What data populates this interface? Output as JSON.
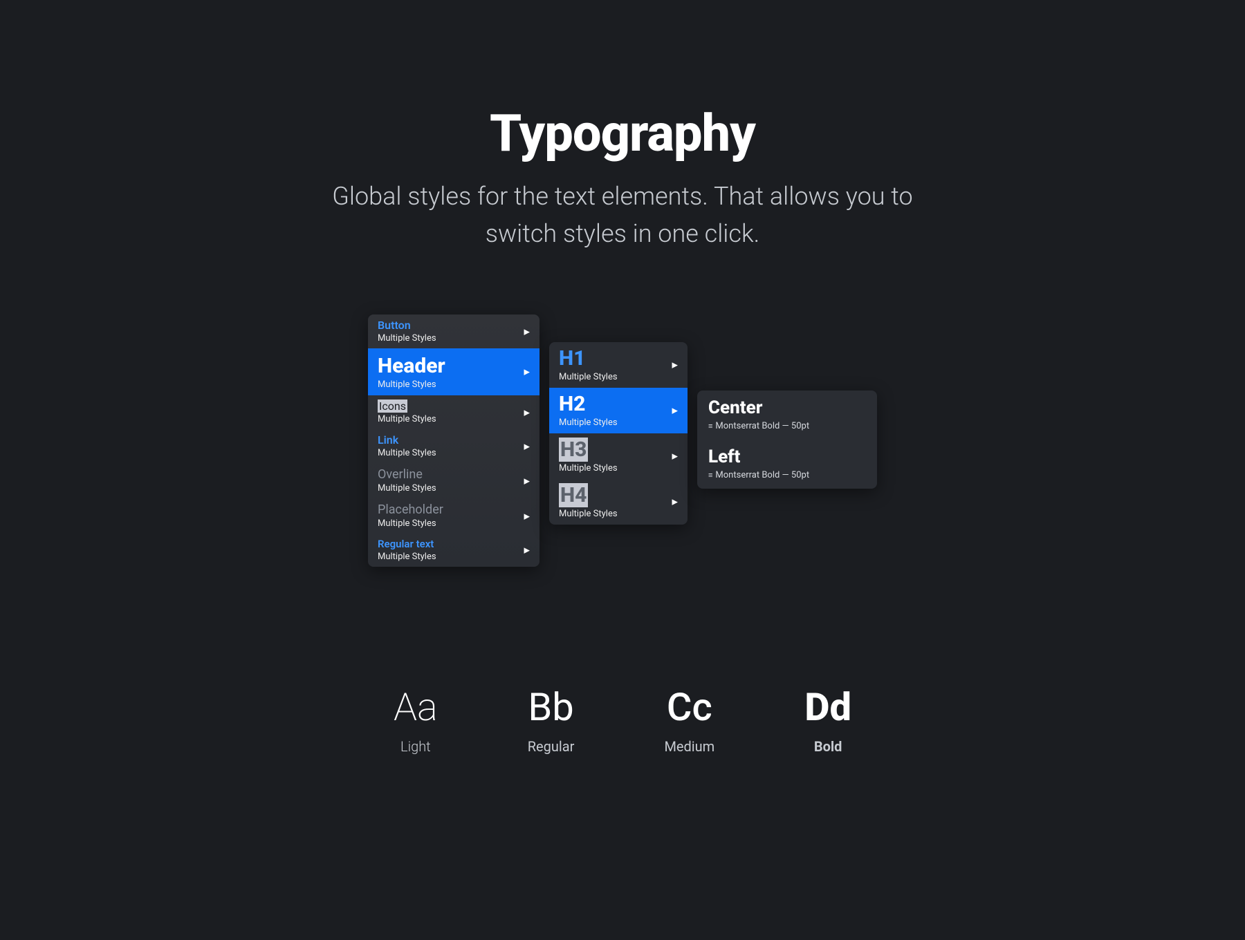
{
  "header": {
    "title": "Typography",
    "subtitle": "Global styles for the text elements. That allows you to switch styles in one click."
  },
  "panel1": {
    "items": [
      {
        "label": "Button",
        "sub": "Multiple Styles"
      },
      {
        "label": "Header",
        "sub": "Multiple Styles"
      },
      {
        "label": "Icons",
        "sub": "Multiple Styles"
      },
      {
        "label": "Link",
        "sub": "Multiple Styles"
      },
      {
        "label": "Overline",
        "sub": "Multiple Styles"
      },
      {
        "label": "Placeholder",
        "sub": "Multiple Styles"
      },
      {
        "label": "Regular text",
        "sub": "Multiple Styles"
      }
    ]
  },
  "panel2": {
    "items": [
      {
        "label": "H1",
        "sub": "Multiple Styles"
      },
      {
        "label": "H2",
        "sub": "Multiple Styles"
      },
      {
        "label": "H3",
        "sub": "Multiple Styles"
      },
      {
        "label": "H4",
        "sub": "Multiple Styles"
      }
    ]
  },
  "panel3": {
    "items": [
      {
        "label": "Center",
        "sub": "Montserrat Bold — 50pt"
      },
      {
        "label": "Left",
        "sub": "Montserrat Bold — 50pt"
      }
    ]
  },
  "weights": [
    {
      "glyph": "Aa",
      "label": "Light"
    },
    {
      "glyph": "Bb",
      "label": "Regular"
    },
    {
      "glyph": "Cc",
      "label": "Medium"
    },
    {
      "glyph": "Dd",
      "label": "Bold"
    }
  ]
}
